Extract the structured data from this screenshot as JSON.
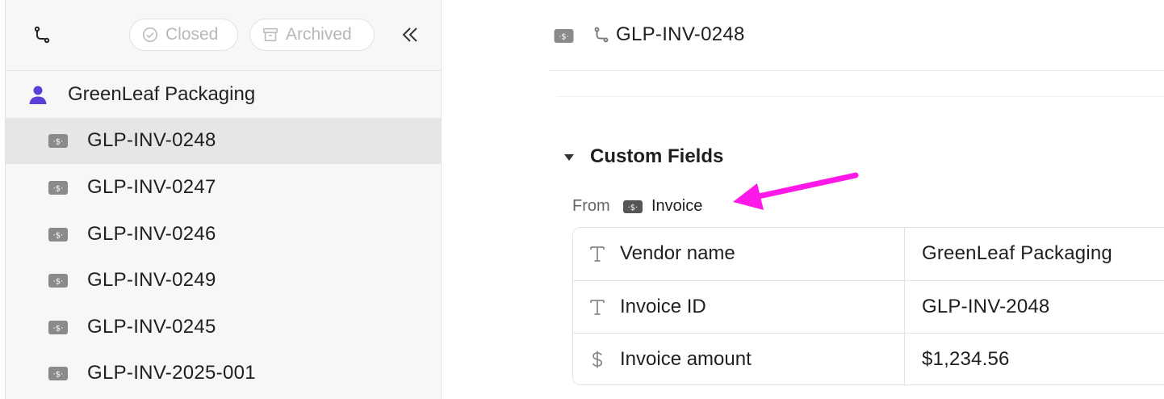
{
  "sidebar": {
    "filters": {
      "closed_label": "Closed",
      "archived_label": "Archived"
    },
    "group": {
      "label": "GreenLeaf Packaging"
    },
    "items": [
      {
        "label": "GLP-INV-0248",
        "selected": true
      },
      {
        "label": "GLP-INV-0247",
        "selected": false
      },
      {
        "label": "GLP-INV-0246",
        "selected": false
      },
      {
        "label": "GLP-INV-0249",
        "selected": false
      },
      {
        "label": "GLP-INV-0245",
        "selected": false
      },
      {
        "label": "GLP-INV-2025-001",
        "selected": false
      }
    ]
  },
  "header": {
    "title": "GLP-INV-0248"
  },
  "section": {
    "title": "Custom Fields",
    "from_label": "From",
    "from_value": "Invoice"
  },
  "fields": [
    {
      "icon": "text-type-icon",
      "name": "Vendor name",
      "value": "GreenLeaf Packaging"
    },
    {
      "icon": "text-type-icon",
      "name": "Invoice ID",
      "value": "GLP-INV-2048"
    },
    {
      "icon": "dollar-icon",
      "name": "Invoice amount",
      "value": "$1,234.56"
    }
  ],
  "colors": {
    "accent_person": "#5b3fd6",
    "annotation_arrow": "#ff19e8",
    "selected_row": "#e6e6e6",
    "sidebar_bg": "#f7f7f7"
  }
}
